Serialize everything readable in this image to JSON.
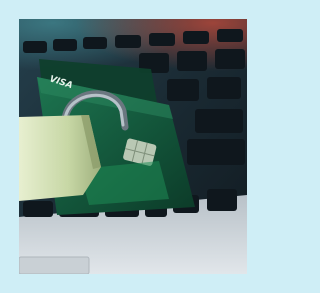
{
  "image": {
    "subject": "",
    "card_text": "VISA"
  },
  "colors": {
    "frame_background": "#cfeef6",
    "keyboard_dark": "#121c24",
    "key_top": "#1a2833",
    "laptop_silver": "#d3d9de",
    "card_green": "#145c3c",
    "padlock_body": "#c9d8a8",
    "chip_gold": "#b9c8b4"
  }
}
